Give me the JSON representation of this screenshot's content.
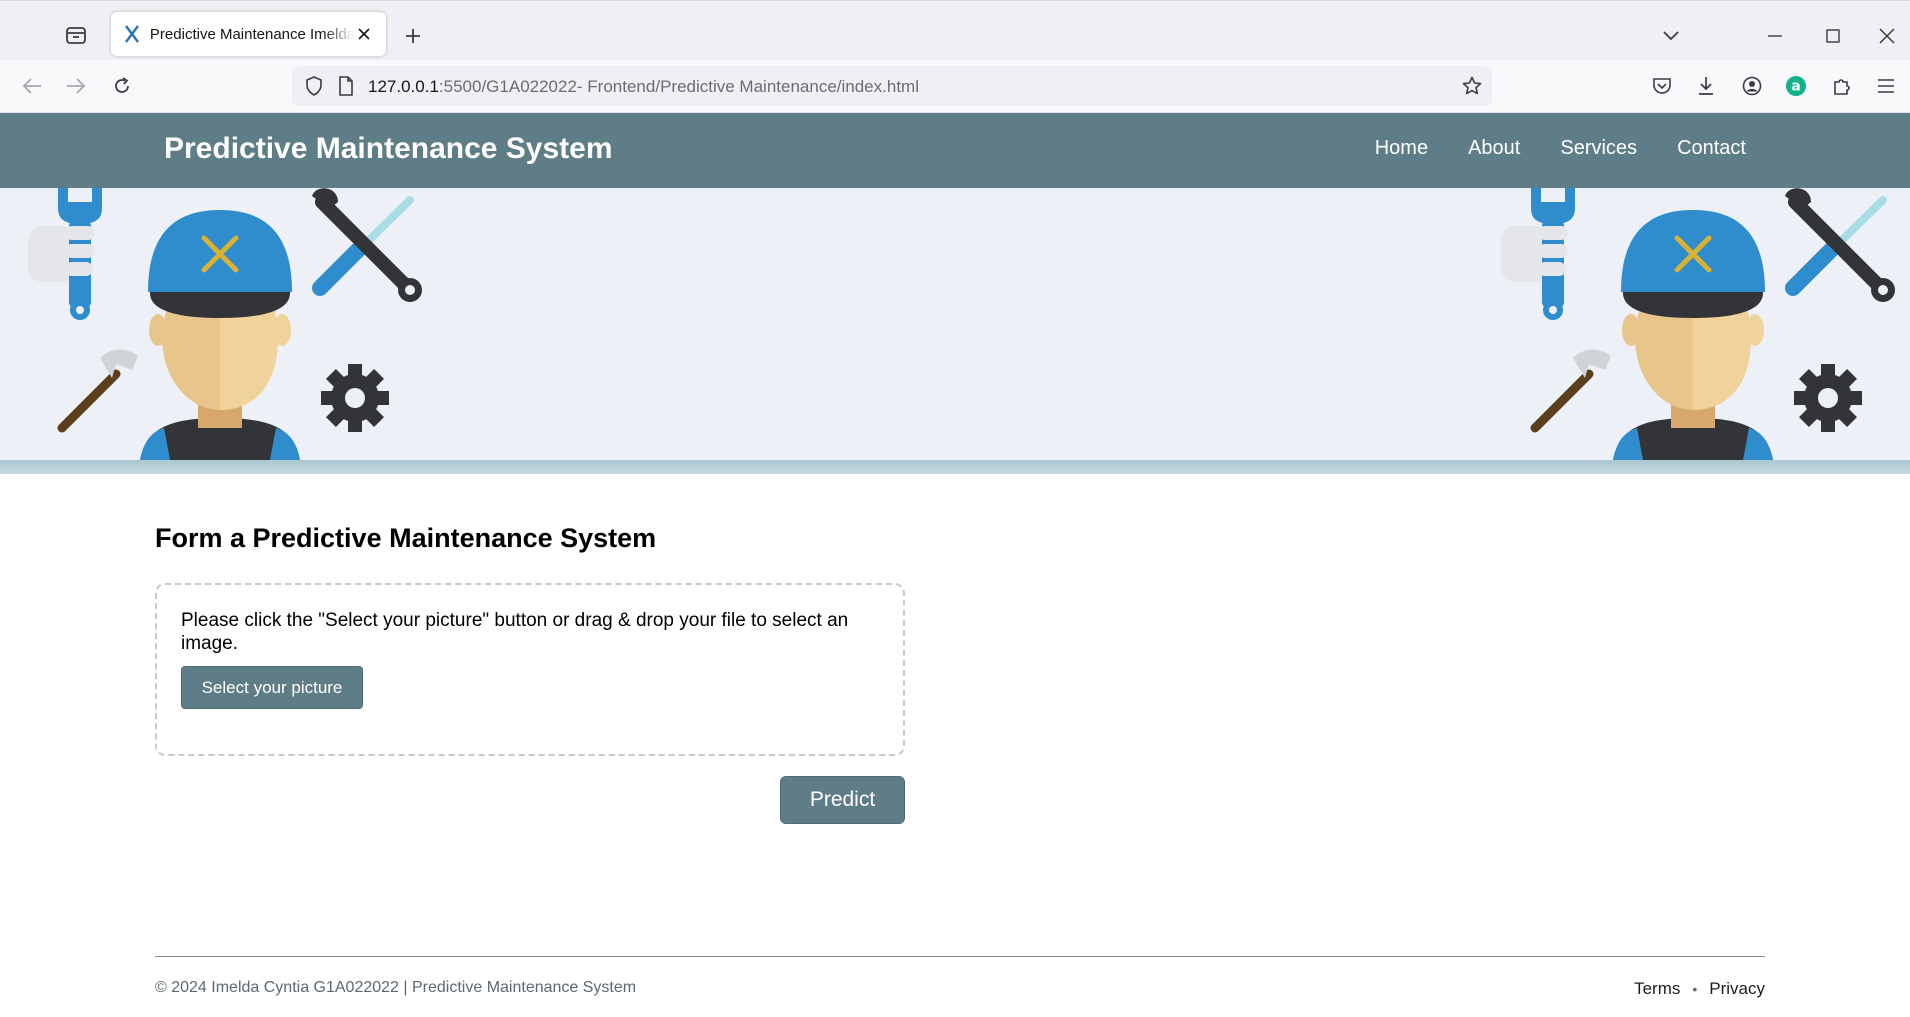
{
  "browser": {
    "tab_title": "Predictive Maintenance Imelda Cyntia",
    "url_host": "127.0.0.1",
    "url_rest": ":5500/G1A022022- Frontend/Predictive Maintenance/index.html"
  },
  "header": {
    "title": "Predictive Maintenance System",
    "nav": [
      "Home",
      "About",
      "Services",
      "Contact"
    ]
  },
  "main": {
    "form_title": "Form a Predictive Maintenance System",
    "upload_instruction": "Please click the \"Select your picture\" button or drag & drop your file to select an image.",
    "select_button_label": "Select your picture",
    "predict_button_label": "Predict"
  },
  "footer": {
    "copyright": "© 2024 Imelda Cyntia G1A022022 | Predictive Maintenance System",
    "links": [
      "Terms",
      "Privacy"
    ],
    "separator": "•"
  },
  "colors": {
    "header_bg": "#5f7d86",
    "hero_bg": "#edf1f7",
    "button_bg": "#5f7d86",
    "helmet_blue": "#2f8ccd"
  }
}
